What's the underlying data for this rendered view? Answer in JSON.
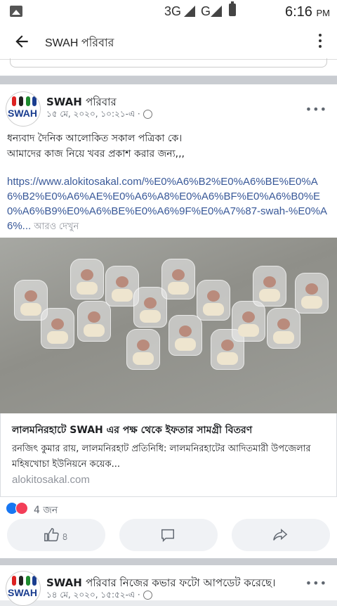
{
  "status_bar": {
    "network1": "3G",
    "network2": "G",
    "time": "6:16",
    "ampm": "PM"
  },
  "app_bar": {
    "title": "SWAH পরিবার"
  },
  "post": {
    "author_bold": "SWAH",
    "author_rest": "পরিবার",
    "timestamp": "১৫ মে, ২০২০, ১০:২১-এ ·",
    "text_line1": "ধন্যবাদ দৈনিক আলোকিত সকাল পত্রিকা কে।",
    "text_line2": "আমাদের কাজ  নিয়ে খবর প্রকাশ করার জন্য,,,",
    "link_text": "https://www.alokitosakal.com/%E0%A6%B2%E0%A6%BE%E0%A6%B2%E0%A6%AE%E0%A6%A8%E0%A6%BF%E0%A6%B0%E0%A6%B9%E0%A6%BE%E0%A6%9F%E0%A7%87-swah-%E0%A6%...",
    "see_more": "আরও দেখুন",
    "link_card": {
      "title": "লালমনিরহাটে SWAH এর পক্ষ থেকে ইফতার সামগ্রী বিতরণ",
      "description": "রনজিৎ কুমার রায়, লালমনিরহাট প্রতিনিধি: লালমনিরহাটের আদিতমারী উপজেলার মহিষখোচা ইউনিয়নে কয়েক...",
      "domain": "alokitosakal.com"
    },
    "reaction_count": "4 জন",
    "like_count": "৪"
  },
  "post2": {
    "author_bold": "SWAH",
    "author_rest": "পরিবার নিজের কভার ফটো আপডেট করেছে।",
    "timestamp": "১৪ মে, ২০২০, ১৫:৫২-এ ·"
  },
  "avatar_text": "SWAH"
}
